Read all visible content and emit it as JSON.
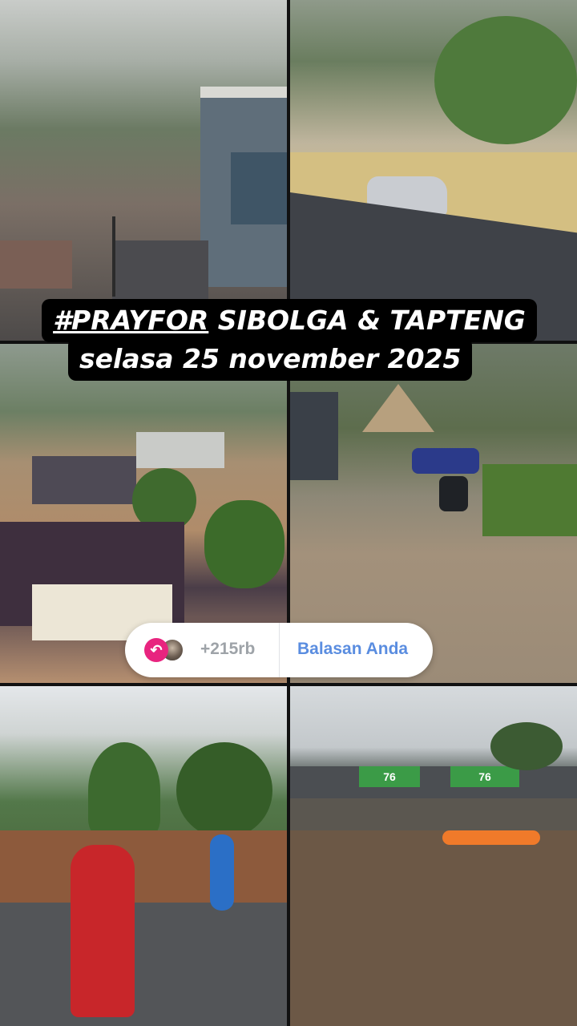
{
  "story": {
    "title_tag": "#PRAYFOR",
    "title_rest": " SIBOLGA & TAPTENG",
    "subtitle": "selasa 25 november 2025"
  },
  "reply_bar": {
    "reply_icon": "reply-arrow-icon",
    "reply_glyph": "↶",
    "count": "+215rb",
    "label": "Balasan Anda",
    "accent_color": "#e8247f",
    "label_color": "#5a8de0"
  },
  "photos": [
    {
      "name": "photo-city-rain"
    },
    {
      "name": "photo-flooded-street-car"
    },
    {
      "name": "photo-flooded-houses-aerial"
    },
    {
      "name": "photo-muddy-road-motorbike"
    },
    {
      "name": "photo-landslide-rescuers"
    },
    {
      "name": "photo-flood-rescue-boat"
    }
  ],
  "photo_signs": {
    "sign_1": "76",
    "sign_2": "76"
  }
}
